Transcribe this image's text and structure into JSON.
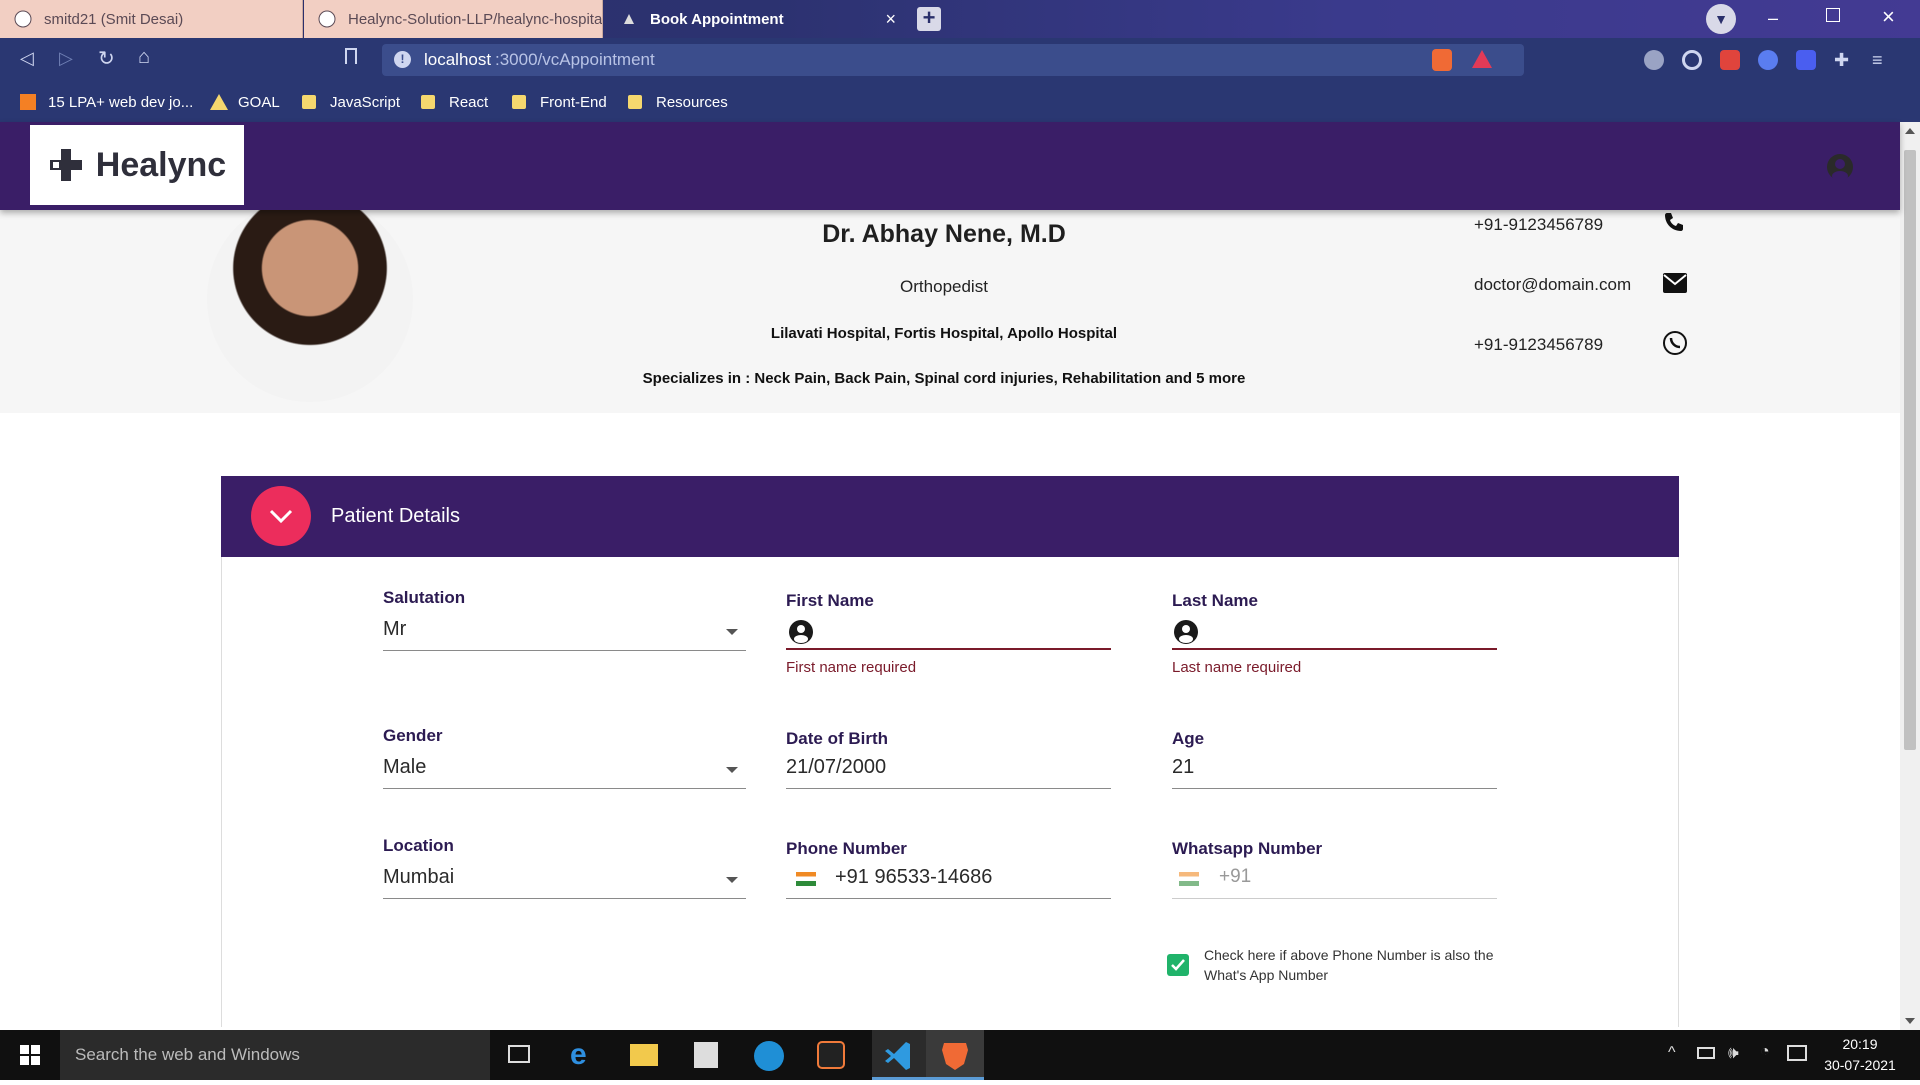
{
  "browser": {
    "tabs": [
      {
        "label": "smitd21 (Smit Desai)",
        "active": false
      },
      {
        "label": "Healync-Solution-LLP/healync-hospital",
        "active": false
      },
      {
        "label": "Book Appointment",
        "active": true
      }
    ],
    "url_host": "localhost",
    "url_path": ":3000/vcAppointment",
    "bookmarks": [
      "15 LPA+ web dev jo...",
      "GOAL",
      "JavaScript",
      "React",
      "Front-End",
      "Resources"
    ]
  },
  "app": {
    "logo_text": "Healync"
  },
  "doctor": {
    "name": "Dr. Abhay Nene, M.D",
    "speciality": "Orthopedist",
    "hospitals": "Lilavati Hospital, Fortis Hospital, Apollo Hospital",
    "specializes": "Specializes in : Neck Pain, Back Pain, Spinal cord injuries, Rehabilitation and 5 more",
    "phone": "+91-9123456789",
    "email": "doctor@domain.com",
    "whatsapp": "+91-9123456789"
  },
  "panel": {
    "title": "Patient Details"
  },
  "form": {
    "salutation": {
      "label": "Salutation",
      "value": "Mr"
    },
    "first_name": {
      "label": "First Name",
      "value": "",
      "error": "First name required"
    },
    "last_name": {
      "label": "Last Name",
      "value": "",
      "error": "Last name required"
    },
    "gender": {
      "label": "Gender",
      "value": "Male"
    },
    "dob": {
      "label": "Date of Birth",
      "value": "21/07/2000"
    },
    "age": {
      "label": "Age",
      "value": "21"
    },
    "location": {
      "label": "Location",
      "value": "Mumbai"
    },
    "phone": {
      "label": "Phone Number",
      "value": "+91 96533-14686"
    },
    "whatsapp": {
      "label": "Whatsapp Number",
      "placeholder": "+91"
    },
    "same_number_checkbox": {
      "label": "Check here if above Phone Number is also the What's App Number",
      "checked": true
    }
  },
  "taskbar": {
    "search_placeholder": "Search the web and Windows",
    "time": "20:19",
    "date": "30-07-2021"
  }
}
